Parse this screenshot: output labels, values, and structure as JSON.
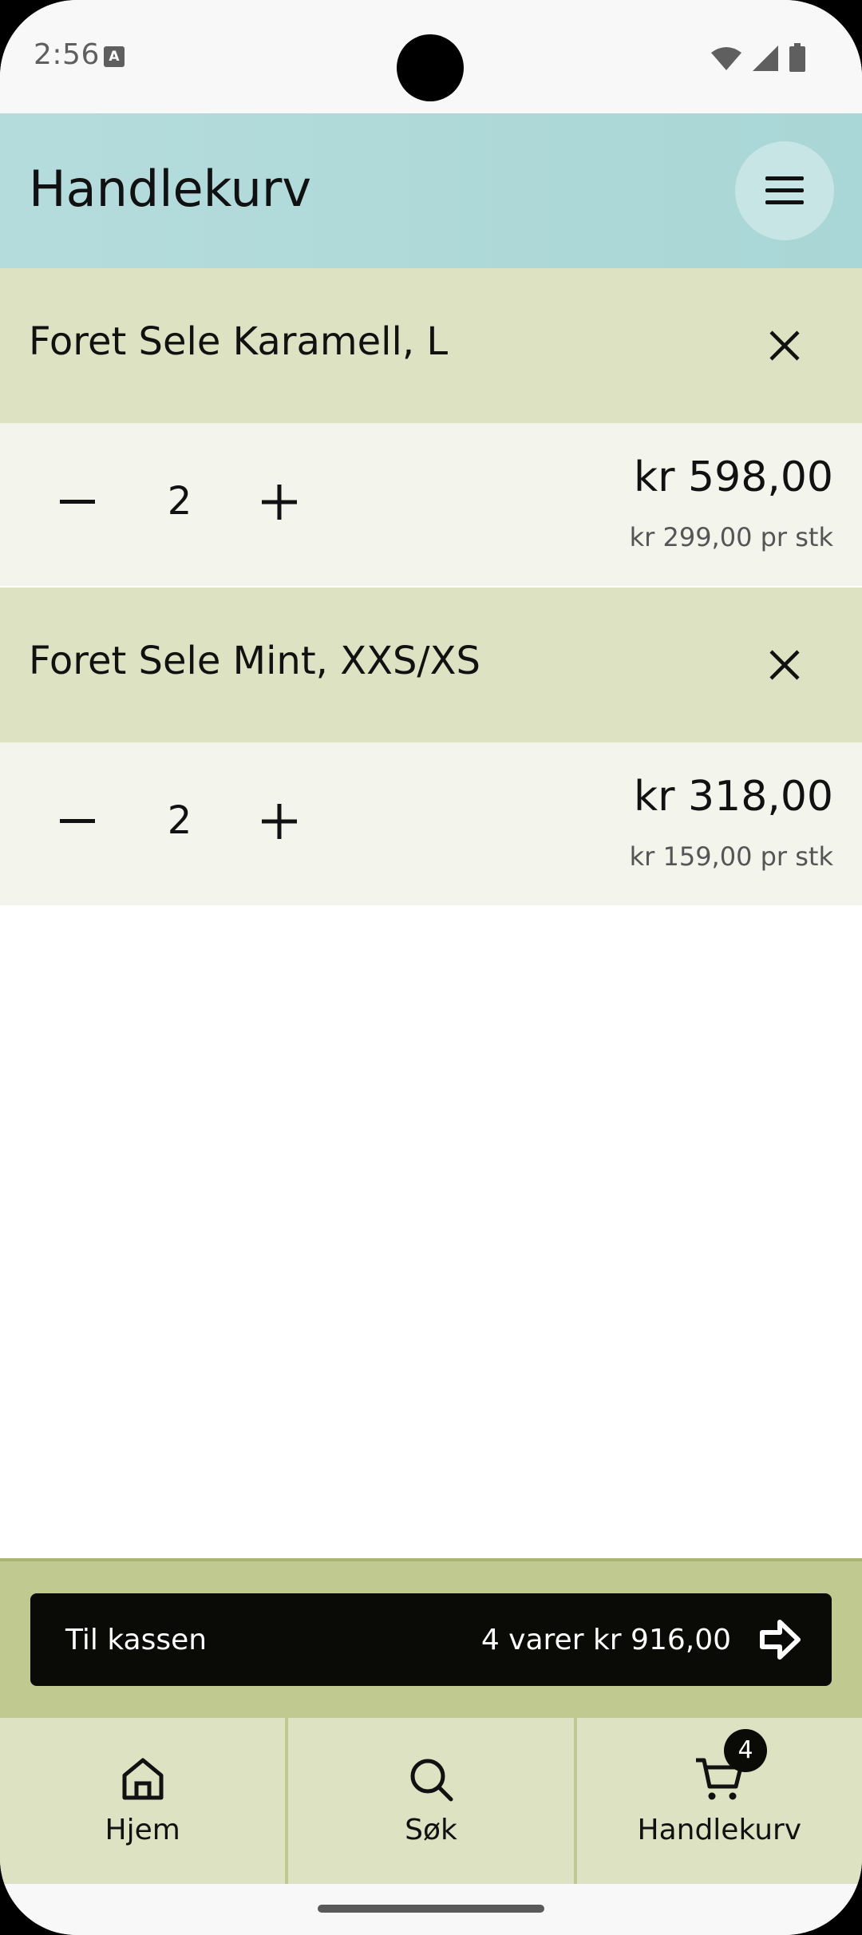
{
  "status_bar": {
    "time": "2:56",
    "notification_icon": "a-icon",
    "icons": [
      "wifi-icon",
      "signal-icon",
      "battery-icon"
    ]
  },
  "app_bar": {
    "title": "Handlekurv",
    "menu_icon": "menu-icon"
  },
  "cart": {
    "items": [
      {
        "name": "Foret Sele Karamell, L",
        "quantity": "2",
        "line_total": "kr 598,00",
        "unit_price": "kr 299,00 pr stk"
      },
      {
        "name": "Foret Sele Mint, XXS/XS",
        "quantity": "2",
        "line_total": "kr 318,00",
        "unit_price": "kr 159,00 pr stk"
      }
    ]
  },
  "checkout": {
    "label": "Til kassen",
    "summary": "4 varer  kr 916,00",
    "icon": "arrow-right-icon"
  },
  "bottom_nav": {
    "items": [
      {
        "label": "Hjem",
        "icon": "home-icon"
      },
      {
        "label": "Søk",
        "icon": "search-icon"
      },
      {
        "label": "Handlekurv",
        "icon": "cart-icon"
      }
    ],
    "cart_badge": "4"
  },
  "colors": {
    "app_bar": "#b1d9d9",
    "item_header": "#dde2c2",
    "item_row": "#f3f4ec",
    "checkout_bar": "#c0c98f",
    "checkout_button": "#0a0a06"
  }
}
